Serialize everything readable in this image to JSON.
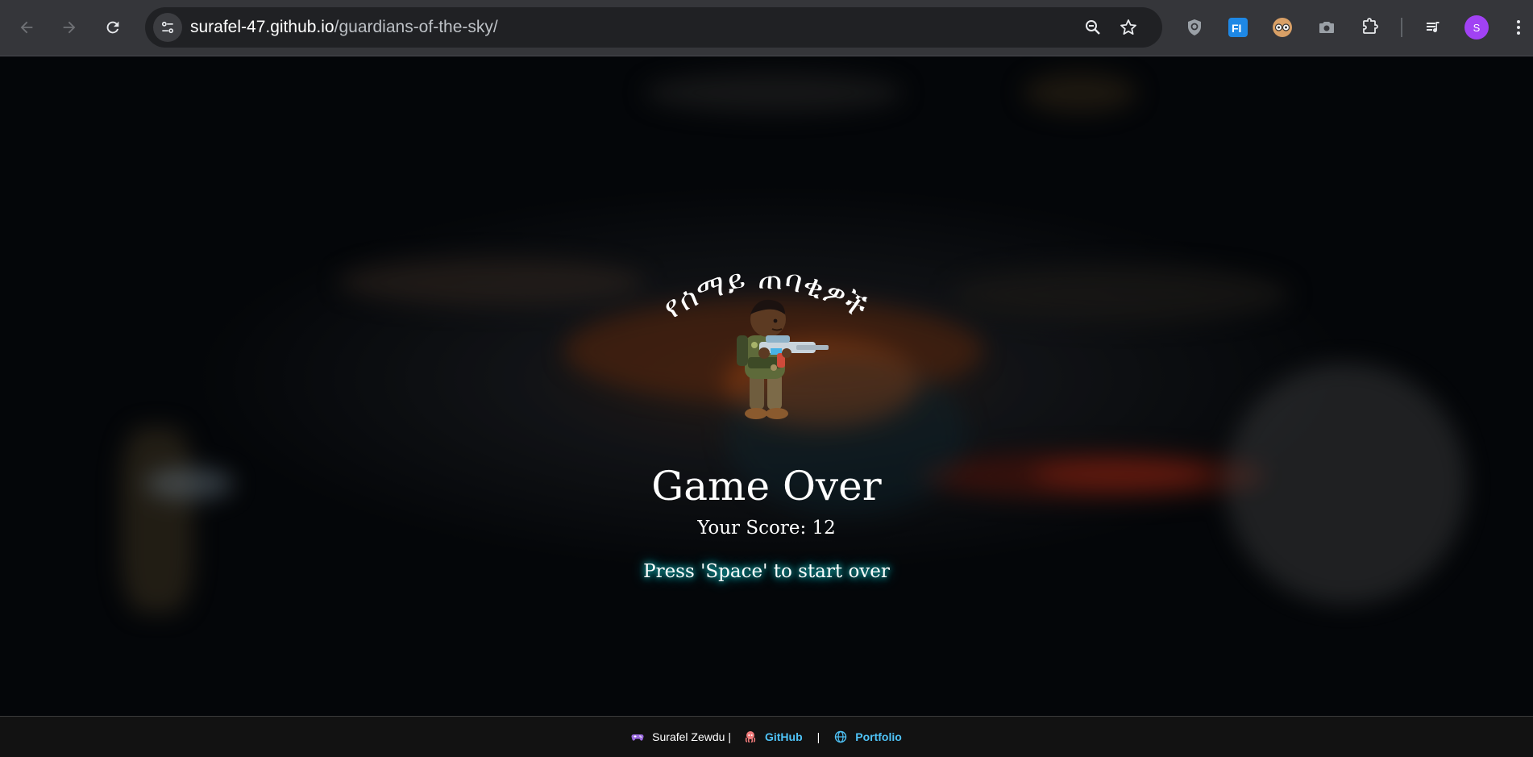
{
  "browser": {
    "url_host": "surafel-47.github.io",
    "url_path": "/guardians-of-the-sky/",
    "profile_initial": "S",
    "icons": {
      "back": "arrow-left-icon",
      "forward": "arrow-right-icon",
      "reload": "reload-icon",
      "site_settings": "tune-icon",
      "zoom": "zoom-out-icon",
      "bookmark": "star-icon",
      "extensions": [
        "shield-extension-icon",
        "fi-extension-icon",
        "glasses-extension-icon",
        "camera-extension-icon",
        "puzzle-extensions-icon",
        "media-queue-icon"
      ]
    }
  },
  "game": {
    "title_amharic": "የሰማይ ጠባቂዎች",
    "status": "Game Over",
    "score_text": "Your Score: 12",
    "restart_prompt": "Press 'Space' to start over"
  },
  "footer": {
    "author_text": "Surafel Zewdu |",
    "github_label": "GitHub",
    "separator": "|",
    "portfolio_label": "Portfolio",
    "link_color": "#4fc3f7"
  },
  "colors": {
    "chrome_bg": "#35363a",
    "omnibox_bg": "#202124",
    "avatar": "#a142f4",
    "glow": "#19e6e6"
  }
}
